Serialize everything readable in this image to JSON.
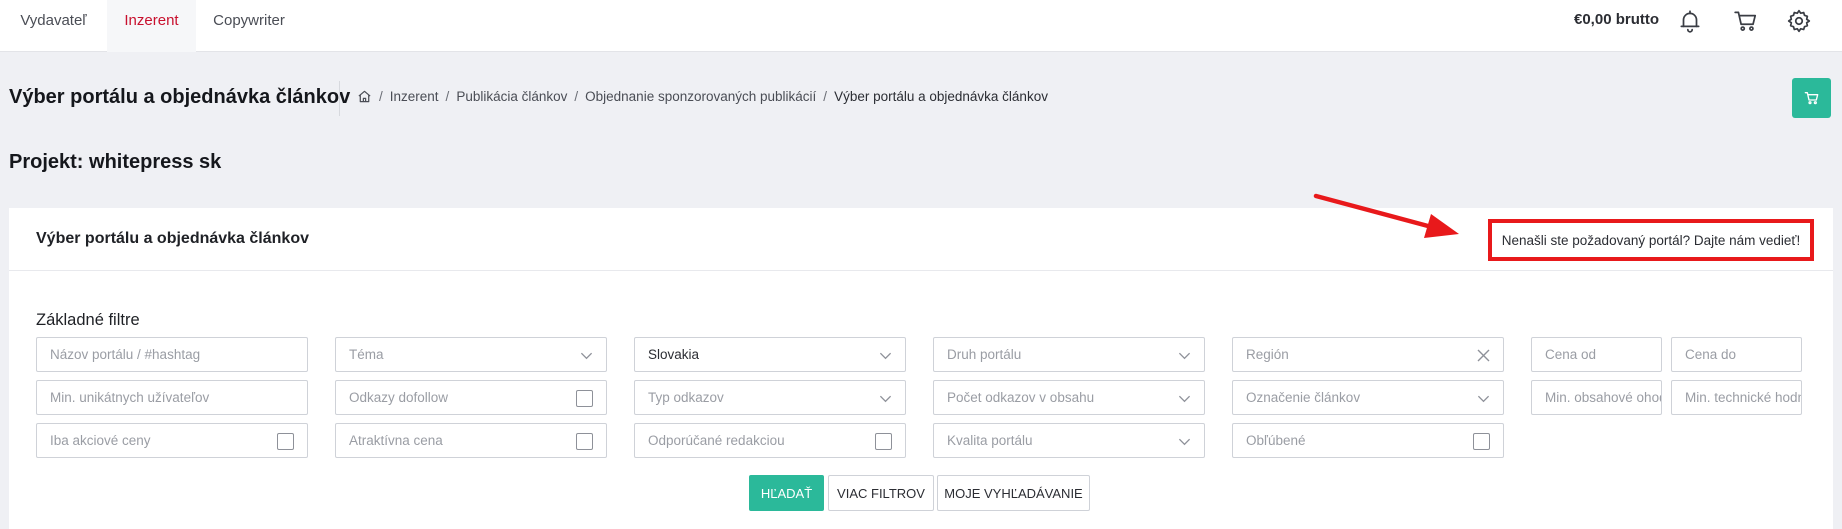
{
  "topbar": {
    "tabs": [
      {
        "label": "Vydavateľ"
      },
      {
        "label": "Inzerent"
      },
      {
        "label": "Copywriter"
      }
    ],
    "cart_total": "€0,00 brutto",
    "icons": [
      "bell-icon",
      "cart-icon",
      "gear-icon"
    ]
  },
  "header": {
    "title": "Výber portálu a objednávka článkov",
    "breadcrumb": [
      "Inzerent",
      "Publikácia článkov",
      "Objednanie sponzorovaných publikácií",
      "Výber portálu a objednávka článkov"
    ]
  },
  "project": {
    "title": "Projekt: whitepress sk"
  },
  "panel": {
    "title": "Výber portálu a objednávka článkov",
    "notice": "Nenašli ste požadovaný portál? Dajte nám vedieť!"
  },
  "filters": {
    "title": "Základné filtre",
    "row1": {
      "portal_name": "Názov portálu / #hashtag",
      "topic": "Téma",
      "country": "Slovakia",
      "portal_type": "Druh portálu",
      "region": "Región",
      "price_from": "Cena od",
      "price_to": "Cena do"
    },
    "row2": {
      "min_users": "Min. unikátnych užívateľov",
      "dofollow": "Odkazy dofollow",
      "link_type": "Typ odkazov",
      "link_count": "Počet odkazov v obsahu",
      "article_mark": "Označenie článkov",
      "min_content": "Min. obsahové ohodnotenie",
      "min_technical": "Min. technické hodnotenie"
    },
    "row3": {
      "promo_prices": "Iba akciové ceny",
      "attractive_price": "Atraktívna cena",
      "recommended": "Odporúčané redakciou",
      "portal_quality": "Kvalita portálu",
      "favorites": "Obľúbené"
    },
    "buttons": {
      "search": "HĽADAŤ",
      "more_filters": "VIAC FILTROV",
      "my_searches": "MOJE VYHĽADÁVANIE"
    }
  },
  "colors": {
    "accent_green": "#2bb99a",
    "active_tab": "#c8102e",
    "annotation_red": "#e8191b"
  }
}
